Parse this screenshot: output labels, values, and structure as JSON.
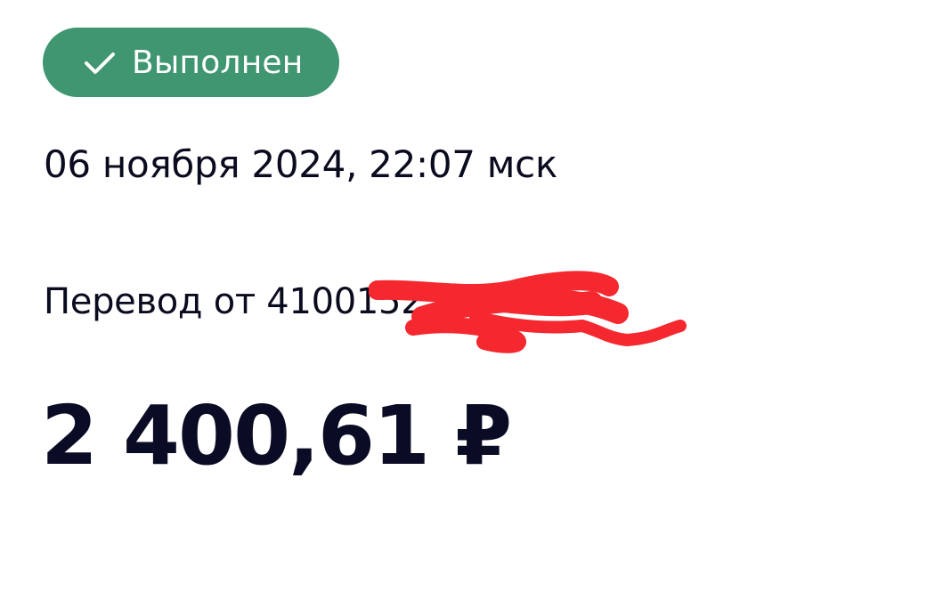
{
  "status": {
    "label": "Выполнен",
    "icon": "check-icon",
    "background_color": "#3f9670"
  },
  "operation": {
    "datetime": "06 ноября 2024, 22:07 мск",
    "transfer_text": "Перевод от 4100152",
    "amount": "2 400,61 ₽"
  },
  "redaction": {
    "icon": "redaction-scribble",
    "color": "#f4282e"
  }
}
